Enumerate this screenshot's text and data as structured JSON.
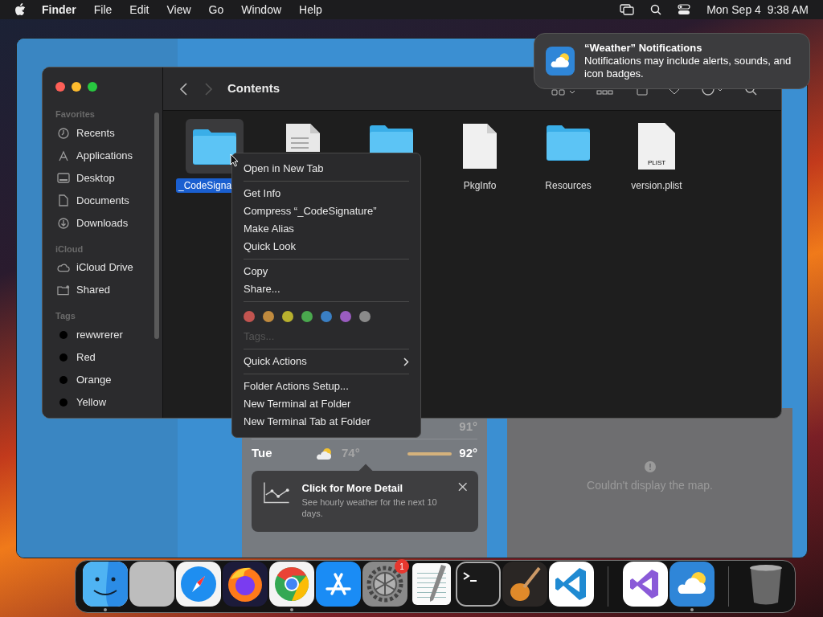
{
  "menubar": {
    "app_name": "Finder",
    "menus": [
      "File",
      "Edit",
      "View",
      "Go",
      "Window",
      "Help"
    ],
    "clock": "Mon Sep 4  9:38 AM"
  },
  "notification": {
    "title": "“Weather” Notifications",
    "body": "Notifications may include alerts, sounds, and icon badges."
  },
  "weather": {
    "rows": [
      {
        "high": "91°"
      },
      {
        "day": "Tue",
        "low": "74°",
        "high": "92°"
      }
    ],
    "tooltip": {
      "title": "Click for More Detail",
      "body": "See hourly weather for the next 10 days."
    },
    "map_message": "Couldn't display the map."
  },
  "finder": {
    "title": "Contents",
    "sidebar": [
      {
        "heading": "Favorites",
        "items": [
          {
            "label": "Recents",
            "kind": "clock"
          },
          {
            "label": "Applications",
            "kind": "apps"
          },
          {
            "label": "Desktop",
            "kind": "desktop"
          },
          {
            "label": "Documents",
            "kind": "doc"
          },
          {
            "label": "Downloads",
            "kind": "download"
          }
        ]
      },
      {
        "heading": "iCloud",
        "items": [
          {
            "label": "iCloud Drive",
            "kind": "cloud"
          },
          {
            "label": "Shared",
            "kind": "shared"
          }
        ]
      },
      {
        "heading": "Tags",
        "items": [
          {
            "label": "rewwrerer",
            "kind": "tag"
          },
          {
            "label": "Red",
            "kind": "tag"
          },
          {
            "label": "Orange",
            "kind": "tag"
          },
          {
            "label": "Yellow",
            "kind": "tag"
          }
        ]
      }
    ],
    "files": [
      {
        "name": "_CodeSigna",
        "kind": "folder",
        "selected": true
      },
      {
        "kind": "doc",
        "selected": false
      },
      {
        "kind": "folder",
        "selected": false
      },
      {
        "name": "PkgInfo",
        "kind": "blank",
        "selected": false
      },
      {
        "name": "Resources",
        "kind": "folder",
        "selected": false
      },
      {
        "name": "version.plist",
        "kind": "plist",
        "badge": "PLIST",
        "selected": false
      }
    ]
  },
  "context_menu": {
    "groups": [
      {
        "items": [
          {
            "kind": "item",
            "label": "Open in New Tab"
          }
        ]
      },
      {
        "items": [
          {
            "kind": "item",
            "label": "Get Info"
          },
          {
            "kind": "item",
            "label": "Compress “_CodeSignature”"
          },
          {
            "kind": "item",
            "label": "Make Alias"
          },
          {
            "kind": "item",
            "label": "Quick Look"
          }
        ]
      },
      {
        "items": [
          {
            "kind": "item",
            "label": "Copy"
          },
          {
            "kind": "item",
            "label": "Share..."
          }
        ]
      },
      {
        "items": [
          {
            "kind": "colors",
            "colors": [
              {
                "color": "#c25450"
              },
              {
                "color": "#c08a3e"
              },
              {
                "color": "#b8b02e"
              },
              {
                "color": "#4aa84e"
              },
              {
                "color": "#3a7fc4"
              },
              {
                "color": "#9a5cc0"
              },
              {
                "color": "#8a8a8a"
              }
            ]
          },
          {
            "kind": "placeholder",
            "label": "Tags..."
          }
        ]
      },
      {
        "items": [
          {
            "kind": "submenu",
            "label": "Quick Actions"
          }
        ]
      },
      {
        "items": [
          {
            "kind": "item",
            "label": "Folder Actions Setup..."
          },
          {
            "kind": "item",
            "label": "New Terminal at Folder"
          },
          {
            "kind": "item",
            "label": "New Terminal Tab at Folder"
          }
        ]
      }
    ]
  },
  "dock": {
    "apps": [
      {
        "kind": "finder",
        "running": true
      },
      {
        "kind": "launchpad",
        "running": false
      },
      {
        "kind": "safari",
        "running": false
      },
      {
        "kind": "firefox",
        "running": false
      },
      {
        "kind": "chrome",
        "running": true
      },
      {
        "kind": "appstore",
        "running": false
      },
      {
        "kind": "settings",
        "running": false,
        "badge": "1"
      },
      {
        "kind": "textedit",
        "running": false
      },
      {
        "kind": "terminal",
        "running": false
      },
      {
        "kind": "garageband",
        "running": false
      },
      {
        "kind": "vscode",
        "running": false
      },
      {
        "kind": "divider"
      },
      {
        "kind": "visualstudio",
        "running": false
      },
      {
        "kind": "weather",
        "running": true
      },
      {
        "kind": "divider"
      },
      {
        "kind": "trash",
        "running": false
      }
    ]
  }
}
